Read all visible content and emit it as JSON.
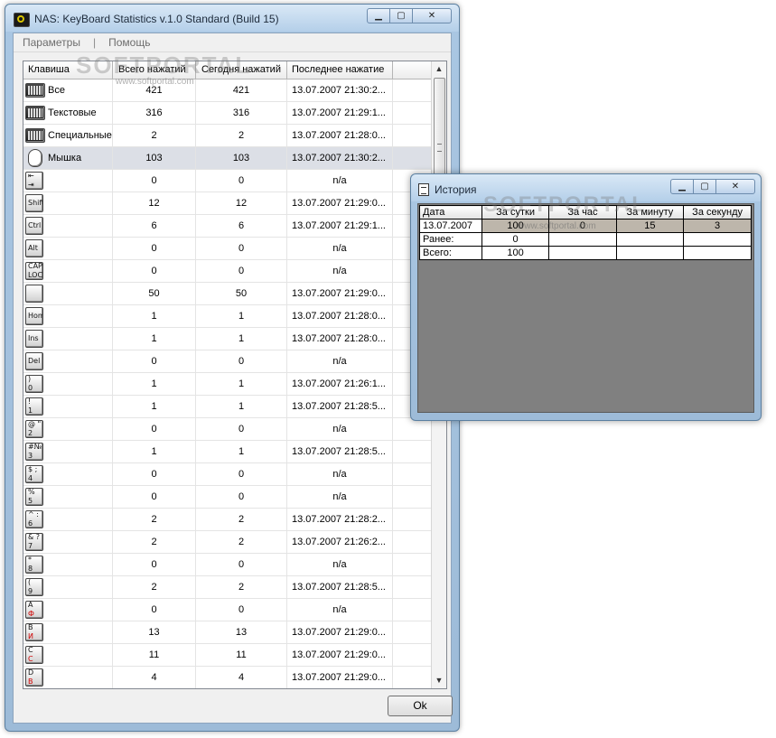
{
  "main": {
    "title": "NAS: KeyBoard Statistics v.1.0 Standard (Build 15)",
    "menu": [
      "Параметры",
      "|",
      "Помощь"
    ],
    "columns": [
      "Клавиша",
      "Всего нажатий",
      "Сегодня нажатий",
      "Последнее нажатие"
    ],
    "rows": [
      {
        "icon": "keyboard-all-icon",
        "label": "Все",
        "total": "421",
        "today": "421",
        "last": "13.07.2007 21:30:2..."
      },
      {
        "icon": "keyboard-text-icon",
        "label": "Текстовые",
        "total": "316",
        "today": "316",
        "last": "13.07.2007 21:29:1..."
      },
      {
        "icon": "keyboard-special-icon",
        "label": "Специальные",
        "total": "2",
        "today": "2",
        "last": "13.07.2007 21:28:0..."
      },
      {
        "icon": "mouse-icon",
        "label": "Мышка",
        "total": "103",
        "today": "103",
        "last": "13.07.2007 21:30:2..."
      },
      {
        "icon": "tab-key-icon",
        "key_top": "⇤",
        "key_bottom": "⇥",
        "label": "",
        "total": "0",
        "today": "0",
        "last": "n/a"
      },
      {
        "icon": "shift-key-icon",
        "key_top": "Shift",
        "key_bottom": "",
        "label": "",
        "total": "12",
        "today": "12",
        "last": "13.07.2007 21:29:0..."
      },
      {
        "icon": "ctrl-key-icon",
        "key_top": "Ctrl",
        "key_bottom": "",
        "label": "",
        "total": "6",
        "today": "6",
        "last": "13.07.2007 21:29:1..."
      },
      {
        "icon": "alt-key-icon",
        "key_top": "Alt",
        "key_bottom": "",
        "label": "",
        "total": "0",
        "today": "0",
        "last": "n/a"
      },
      {
        "icon": "capslock-key-icon",
        "key_top": "CAPS",
        "key_bottom": "LOCK",
        "label": "",
        "total": "0",
        "today": "0",
        "last": "n/a"
      },
      {
        "icon": "space-key-icon",
        "key_top": "",
        "key_bottom": "",
        "label": "",
        "total": "50",
        "today": "50",
        "last": "13.07.2007 21:29:0..."
      },
      {
        "icon": "home-key-icon",
        "key_top": "Home",
        "key_bottom": "",
        "label": "",
        "total": "1",
        "today": "1",
        "last": "13.07.2007 21:28:0..."
      },
      {
        "icon": "ins-key-icon",
        "key_top": "Ins",
        "key_bottom": "",
        "label": "",
        "total": "1",
        "today": "1",
        "last": "13.07.2007 21:28:0..."
      },
      {
        "icon": "del-key-icon",
        "key_top": "Del",
        "key_bottom": "",
        "label": "",
        "total": "0",
        "today": "0",
        "last": "n/a"
      },
      {
        "icon": "key-0-icon",
        "key_top": ")",
        "key_bottom": "0",
        "label": "",
        "total": "1",
        "today": "1",
        "last": "13.07.2007 21:26:1..."
      },
      {
        "icon": "key-1-icon",
        "key_top": "!",
        "key_bottom": "1",
        "label": "",
        "total": "1",
        "today": "1",
        "last": "13.07.2007 21:28:5..."
      },
      {
        "icon": "key-2-icon",
        "key_top": "@ \"",
        "key_bottom": "2",
        "label": "",
        "total": "0",
        "today": "0",
        "last": "n/a"
      },
      {
        "icon": "key-3-icon",
        "key_top": "#№",
        "key_bottom": "3",
        "label": "",
        "total": "1",
        "today": "1",
        "last": "13.07.2007 21:28:5..."
      },
      {
        "icon": "key-4-icon",
        "key_top": "$ ;",
        "key_bottom": "4",
        "label": "",
        "total": "0",
        "today": "0",
        "last": "n/a"
      },
      {
        "icon": "key-5-icon",
        "key_top": "%",
        "key_bottom": "5",
        "label": "",
        "total": "0",
        "today": "0",
        "last": "n/a"
      },
      {
        "icon": "key-6-icon",
        "key_top": "^ :",
        "key_bottom": "6",
        "label": "",
        "total": "2",
        "today": "2",
        "last": "13.07.2007 21:28:2..."
      },
      {
        "icon": "key-7-icon",
        "key_top": "& ?",
        "key_bottom": "7",
        "label": "",
        "total": "2",
        "today": "2",
        "last": "13.07.2007 21:26:2..."
      },
      {
        "icon": "key-8-icon",
        "key_top": "*",
        "key_bottom": "8",
        "label": "",
        "total": "0",
        "today": "0",
        "last": "n/a"
      },
      {
        "icon": "key-9-icon",
        "key_top": "(",
        "key_bottom": "9",
        "label": "",
        "total": "2",
        "today": "2",
        "last": "13.07.2007 21:28:5..."
      },
      {
        "icon": "key-a-icon",
        "key_top": "A",
        "key_bottom": "Ф",
        "label": "",
        "total": "0",
        "today": "0",
        "last": "n/a"
      },
      {
        "icon": "key-b-icon",
        "key_top": "B",
        "key_bottom": "И",
        "label": "",
        "total": "13",
        "today": "13",
        "last": "13.07.2007 21:29:0..."
      },
      {
        "icon": "key-c-icon",
        "key_top": "C",
        "key_bottom": "С",
        "label": "",
        "total": "11",
        "today": "11",
        "last": "13.07.2007 21:29:0..."
      },
      {
        "icon": "key-d-icon",
        "key_top": "D",
        "key_bottom": "В",
        "label": "",
        "total": "4",
        "today": "4",
        "last": "13.07.2007 21:29:0..."
      }
    ],
    "selected_row": 3,
    "ok_label": "Ok"
  },
  "history": {
    "title": "История",
    "columns": [
      "Дата",
      "За сутки",
      "За час",
      "За минуту",
      "За секунду"
    ],
    "rows": [
      [
        "13.07.2007",
        "100",
        "0",
        "15",
        "3"
      ],
      [
        "Ранее:",
        "0",
        "",
        "",
        ""
      ],
      [
        "Всего:",
        "100",
        "",
        "",
        ""
      ]
    ]
  },
  "watermark": {
    "brand": "SOFTPORTAL",
    "url": "www.softportal.com"
  },
  "colors": {
    "titlebar": "#b4cfe9",
    "selected_row": "#dcdfe6",
    "history_selected": "#bdb6ab",
    "history_bg": "#808080"
  }
}
